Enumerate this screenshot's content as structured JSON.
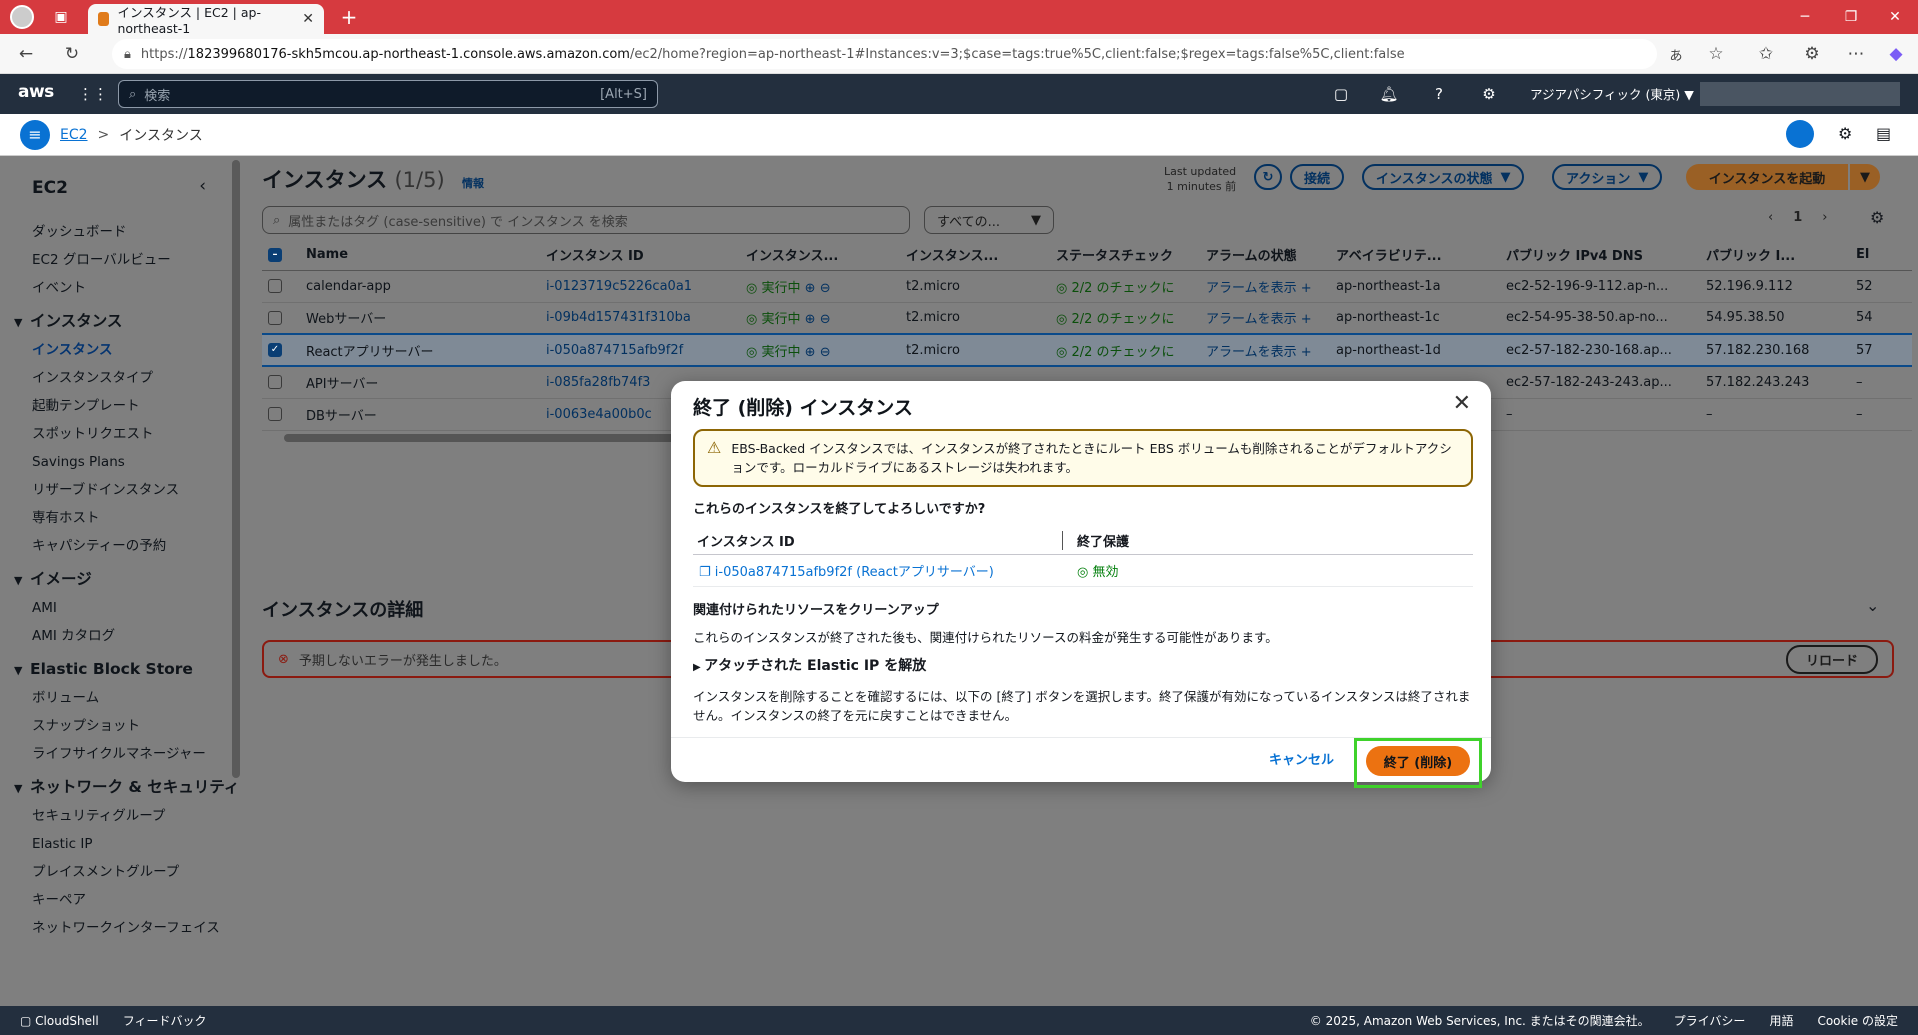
{
  "browser": {
    "tab_title": "インスタンス | EC2 | ap-northeast-1",
    "url_prefix": "https://",
    "url_host": "182399680176-skh5mcou.ap-northeast-1.console.aws.amazon.com",
    "url_path": "/ec2/home?region=ap-northeast-1#Instances:v=3;$case=tags:true%5C,client:false;$regex=tags:false%5C,client:false"
  },
  "aws_header": {
    "logo": "aws",
    "search_placeholder": "検索",
    "search_shortcut": "[Alt+S]",
    "region": "アジアパシフィック (東京) ▼"
  },
  "breadcrumb": {
    "root": "EC2",
    "sep": ">",
    "current": "インスタンス"
  },
  "sidebar": {
    "title": "EC2",
    "top_items": [
      "ダッシュボード",
      "EC2 グローバルビュー",
      "イベント"
    ],
    "sections": [
      {
        "label": "インスタンス",
        "items": [
          "インスタンス",
          "インスタンスタイプ",
          "起動テンプレート",
          "スポットリクエスト",
          "Savings Plans",
          "リザーブドインスタンス",
          "専有ホスト",
          "キャパシティーの予約"
        ]
      },
      {
        "label": "イメージ",
        "items": [
          "AMI",
          "AMI カタログ"
        ]
      },
      {
        "label": "Elastic Block Store",
        "items": [
          "ボリューム",
          "スナップショット",
          "ライフサイクルマネージャー"
        ]
      },
      {
        "label": "ネットワーク & セキュリティ",
        "items": [
          "セキュリティグループ",
          "Elastic IP",
          "プレイスメントグループ",
          "キーペア",
          "ネットワークインターフェイス"
        ]
      }
    ]
  },
  "main": {
    "title": "インスタンス",
    "count": "(1/5)",
    "info": "情報",
    "last_updated": "Last updated",
    "last_updated_ago": "1 minutes 前",
    "btn_connect": "接続",
    "btn_state": "インスタンスの状態",
    "btn_actions": "アクション",
    "btn_launch": "インスタンスを起動",
    "filter_placeholder": "属性またはタグ (case-sensitive) で インスタンス を検索",
    "select_value": "すべての...",
    "page": "1",
    "columns": [
      "Name",
      "インスタンス ID",
      "インスタンス...",
      "インスタンス...",
      "ステータスチェック",
      "アラームの状態",
      "アベイラビリテ...",
      "パブリック IPv4 DNS",
      "パブリック I...",
      "El"
    ],
    "rows": [
      {
        "name": "calendar-app",
        "id": "i-0123719c5226ca0a1",
        "state": "実行中",
        "type": "t2.micro",
        "status": "2/2 のチェックに",
        "alarm": "アラームを表示",
        "az": "ap-northeast-1a",
        "dns": "ec2-52-196-9-112.ap-n...",
        "ip": "52.196.9.112",
        "el": "52"
      },
      {
        "name": "Webサーバー",
        "id": "i-09b4d157431f310ba",
        "state": "実行中",
        "type": "t2.micro",
        "status": "2/2 のチェックに",
        "alarm": "アラームを表示",
        "az": "ap-northeast-1c",
        "dns": "ec2-54-95-38-50.ap-no...",
        "ip": "54.95.38.50",
        "el": "54"
      },
      {
        "name": "Reactアプリサーバー",
        "id": "i-050a874715afb9f2f",
        "state": "実行中",
        "type": "t2.micro",
        "status": "2/2 のチェックに",
        "alarm": "アラームを表示",
        "az": "ap-northeast-1d",
        "dns": "ec2-57-182-230-168.ap...",
        "ip": "57.182.230.168",
        "el": "57"
      },
      {
        "name": "APIサーバー",
        "id": "i-085fa28fb74f3",
        "state": "",
        "type": "",
        "status": "",
        "alarm": "",
        "az": "",
        "dns": "ec2-57-182-243-243.ap...",
        "ip": "57.182.243.243",
        "el": "–"
      },
      {
        "name": "DBサーバー",
        "id": "i-0063e4a00b0c",
        "state": "",
        "type": "",
        "status": "",
        "alarm": "",
        "az": "",
        "dns": "–",
        "ip": "–",
        "el": "–"
      }
    ],
    "details_title": "インスタンスの詳細",
    "error_text": "予期しないエラーが発生しました。",
    "reload": "リロード"
  },
  "modal": {
    "title": "終了 (削除) インスタンス",
    "warning": "EBS-Backed インスタンスでは、インスタンスが終了されたときにルート EBS ボリュームも削除されることがデフォルトアクションです。ローカルドライブにあるストレージは失われます。",
    "question": "これらのインスタンスを終了してよろしいですか?",
    "col_id": "インスタンス ID",
    "col_protect": "終了保護",
    "instance_link": "i-050a874715afb9f2f (Reactアプリサーバー)",
    "protect_value": "無効",
    "cleanup_title": "関連付けられたリソースをクリーンアップ",
    "cleanup_text": "これらのインスタンスが終了された後も、関連付けられたリソースの料金が発生する可能性があります。",
    "expand_label": "アタッチされた Elastic IP を解放",
    "confirm_text": "インスタンスを削除することを確認するには、以下の [終了] ボタンを選択します。終了保護が有効になっているインスタンスは終了されません。インスタンスの終了を元に戻すことはできません。",
    "cancel": "キャンセル",
    "terminate": "終了 (削除)"
  },
  "footer": {
    "cloudshell": "CloudShell",
    "feedback": "フィードバック",
    "copyright": "© 2025, Amazon Web Services, Inc. またはその関連会社。",
    "privacy": "プライバシー",
    "terms": "用語",
    "cookie": "Cookie の設定"
  }
}
